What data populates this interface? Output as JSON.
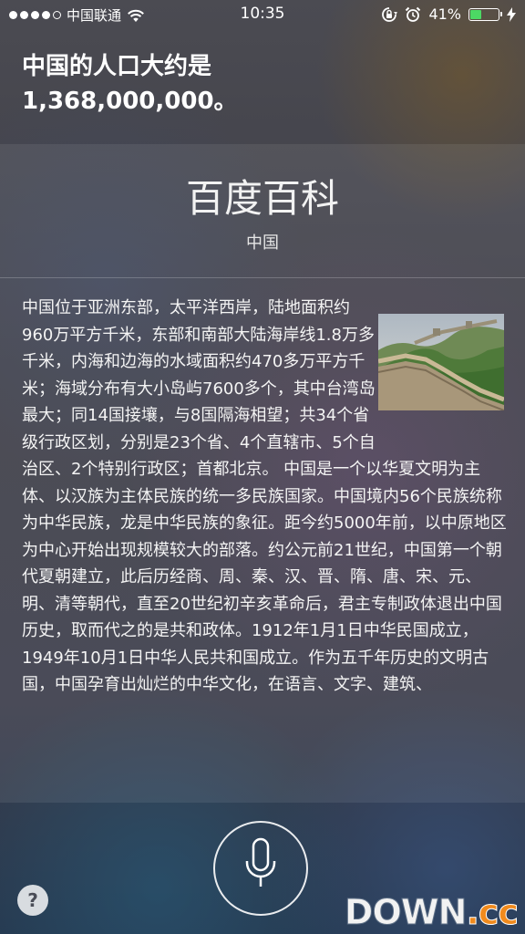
{
  "status_bar": {
    "carrier": "中国联通",
    "time": "10:35",
    "battery_percent_label": "41%",
    "battery_level": 0.41,
    "signal_bars_filled": 4,
    "signal_bars_total": 5,
    "icons": [
      "wifi-icon",
      "orientation-lock-icon",
      "alarm-icon",
      "battery-icon",
      "charging-bolt-icon"
    ]
  },
  "answer": {
    "line1": "中国的人口大约是",
    "line2": "1,368,000,000。"
  },
  "card": {
    "title": "百度百科",
    "subtitle": "中国",
    "thumbnail": "great-wall-photo",
    "body": "中国位于亚洲东部，太平洋西岸，陆地面积约960万平方千米，东部和南部大陆海岸线1.8万多千米，内海和边海的水域面积约470多万平方千米；海域分布有大小岛屿7600多个，其中台湾岛最大；同14国接壤，与8国隔海相望；共34个省级行政区划，分别是23个省、4个直辖市、5个自治区、2个特别行政区；首都北京。 中国是一个以华夏文明为主体、以汉族为主体民族的统一多民族国家。中国境内56个民族统称为中华民族，龙是中华民族的象征。距今约5000年前，以中原地区为中心开始出现规模较大的部落。约公元前21世纪，中国第一个朝代夏朝建立，此后历经商、周、秦、汉、晋、隋、唐、宋、元、明、清等朝代，直至20世纪初辛亥革命后，君主专制政体退出中国历史，取而代之的是共和政体。1912年1月1日中华民国成立，1949年10月1日中华人民共和国成立。作为五千年历史的文明古国，中国孕育出灿烂的中华文化，在语言、文字、建筑、"
  },
  "controls": {
    "mic_icon": "microphone-icon",
    "help_label": "?"
  },
  "watermark": {
    "main": "DOWN",
    "accent": ".cc"
  },
  "colors": {
    "battery_fill": "#4cd964",
    "watermark_accent": "#f08a1d"
  }
}
